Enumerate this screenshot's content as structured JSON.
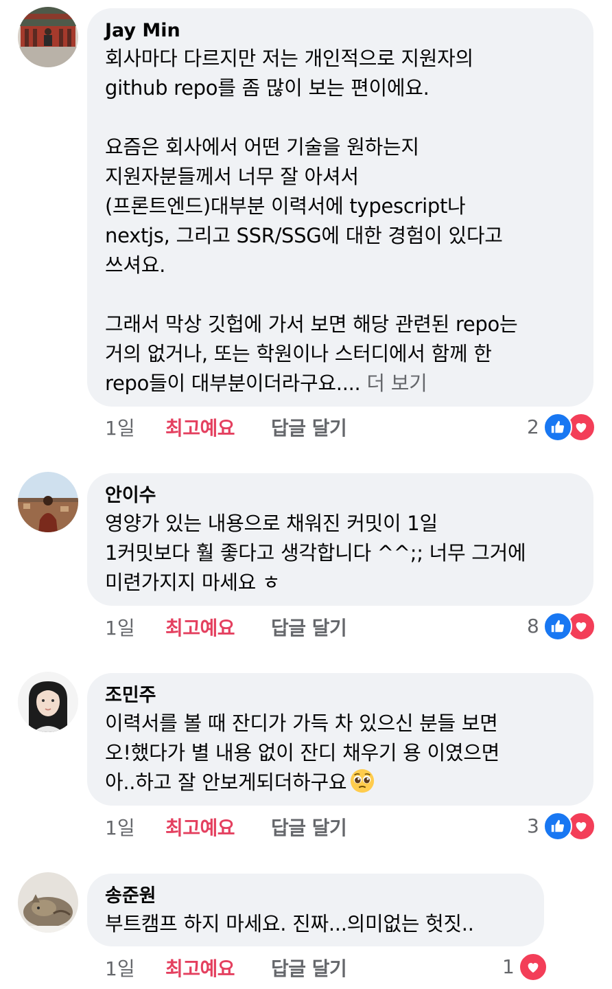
{
  "comments": [
    {
      "author": "Jay Min",
      "lines": [
        "회사마다 다르지만 저는 개인적으로 지원자의",
        "github repo를 좀 많이 보는 편이에요.",
        "",
        "요즘은 회사에서 어떤 기술을 원하는지",
        "지원자분들께서 너무 잘 아셔서",
        "(프론트엔드)대부분 이력서에 typescript나",
        "nextjs, 그리고 SSR/SSG에 대한 경험이 있다고",
        "쓰셔요.",
        "",
        "그래서 막상 깃헙에 가서 보면 해당 관련된 repo는",
        "거의 없거나, 또는 학원이나 스터디에서 함께 한",
        "repo들이 대부분이더라구요...."
      ],
      "see_more": "더 보기",
      "time": "1일",
      "like_label": "최고예요",
      "reply_label": "답글 달기",
      "reaction_count": "2",
      "reactions": [
        "like-icon",
        "love-icon"
      ]
    },
    {
      "author": "안이수",
      "lines": [
        "영양가 있는 내용으로 채워진 커밋이 1일",
        "1커밋보다 훨 좋다고 생각합니다 ^^;; 너무 그거에",
        "미련가지지 마세요 ㅎ"
      ],
      "time": "1일",
      "like_label": "최고예요",
      "reply_label": "답글 달기",
      "reaction_count": "8",
      "reactions": [
        "like-icon",
        "love-icon"
      ]
    },
    {
      "author": "조민주",
      "lines": [
        "이력서를 볼 때 잔디가 가득 차 있으신 분들 보면",
        "오!했다가 별 내용 없이 잔디 채우기 용 이였으면",
        "아..하고 잘 안보게되더하구요"
      ],
      "emoji": "pleading-face-emoji",
      "time": "1일",
      "like_label": "최고예요",
      "reply_label": "답글 달기",
      "reaction_count": "3",
      "reactions": [
        "like-icon",
        "love-icon"
      ]
    },
    {
      "author": "송준원",
      "lines": [
        "부트캠프 하지 마세요. 진짜...의미없는 헛짓.."
      ],
      "time": "1일",
      "like_label": "최고예요",
      "reply_label": "답글 달기",
      "reaction_count": "1",
      "reactions": [
        "love-icon"
      ]
    }
  ],
  "colors": {
    "bubble_bg": "#f0f2f5",
    "like_text": "#e4405f",
    "secondary_text": "#65676b",
    "like_reaction": "#1877f2",
    "love_reaction": "#f33e58"
  }
}
